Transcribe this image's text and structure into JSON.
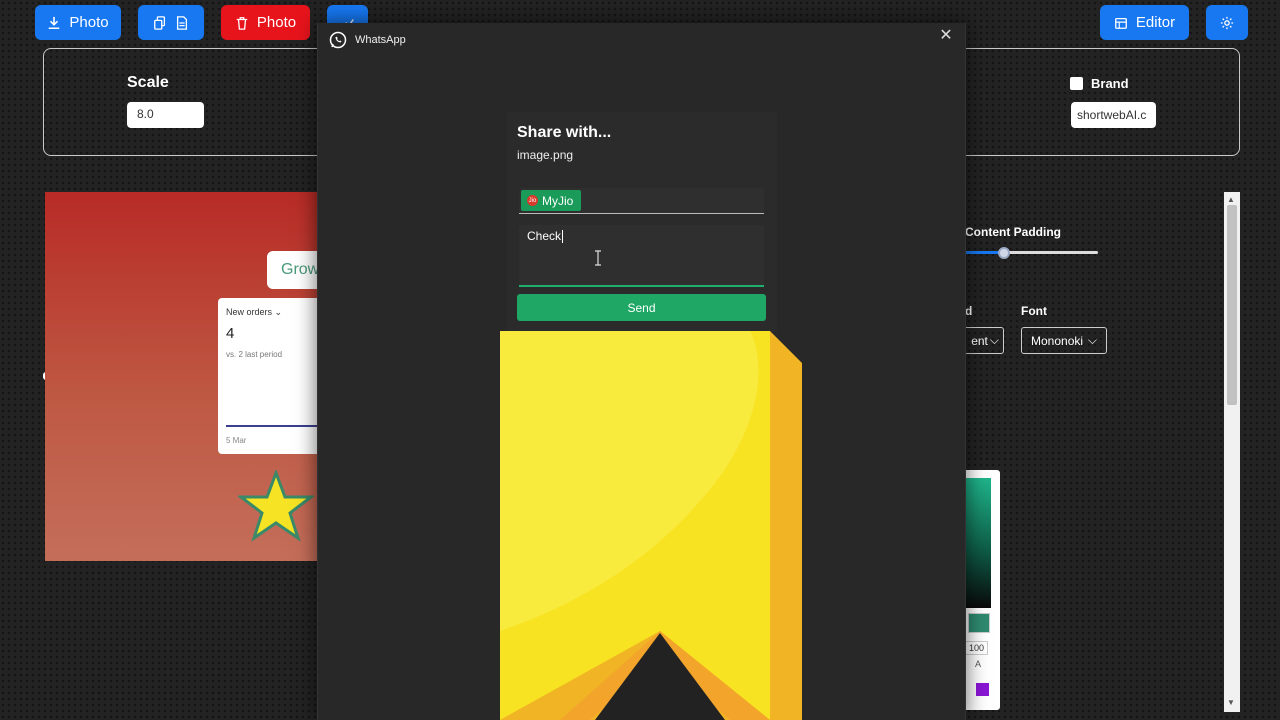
{
  "toolbar": {
    "download_photo_label": "Photo",
    "delete_photo_label": "Photo",
    "editor_label": "Editor"
  },
  "settings": {
    "scale_label": "Scale",
    "scale_value": "8.0",
    "brand_label": "Brand",
    "brand_value": "shortwebAI.c"
  },
  "preview": {
    "pill_text": "Grow",
    "card_title": "New orders",
    "card_value": "4",
    "card_subtitle": "vs. 2 last period",
    "card_date": "5 Mar"
  },
  "controls": {
    "content_padding_label": "Content Padding",
    "content_padding_value": 0.28,
    "background_label_partial": "d",
    "background_value_partial": "ent",
    "font_label": "Font",
    "font_value": "Mononoki",
    "alpha_value": "100",
    "alpha_label": "A"
  },
  "colors": {
    "accent": "#1778f2",
    "danger": "#e8141c",
    "whatsapp_green": "#1fa865",
    "picker_selected": "#2e8a6f",
    "picker_purple": "#8a16d6"
  },
  "share": {
    "window_title": "WhatsApp",
    "title": "Share with...",
    "filename": "image.png",
    "recipient": "MyJio",
    "recipient_icon": "Jio",
    "message": "Check",
    "send_label": "Send",
    "close_icon": "close-icon"
  }
}
